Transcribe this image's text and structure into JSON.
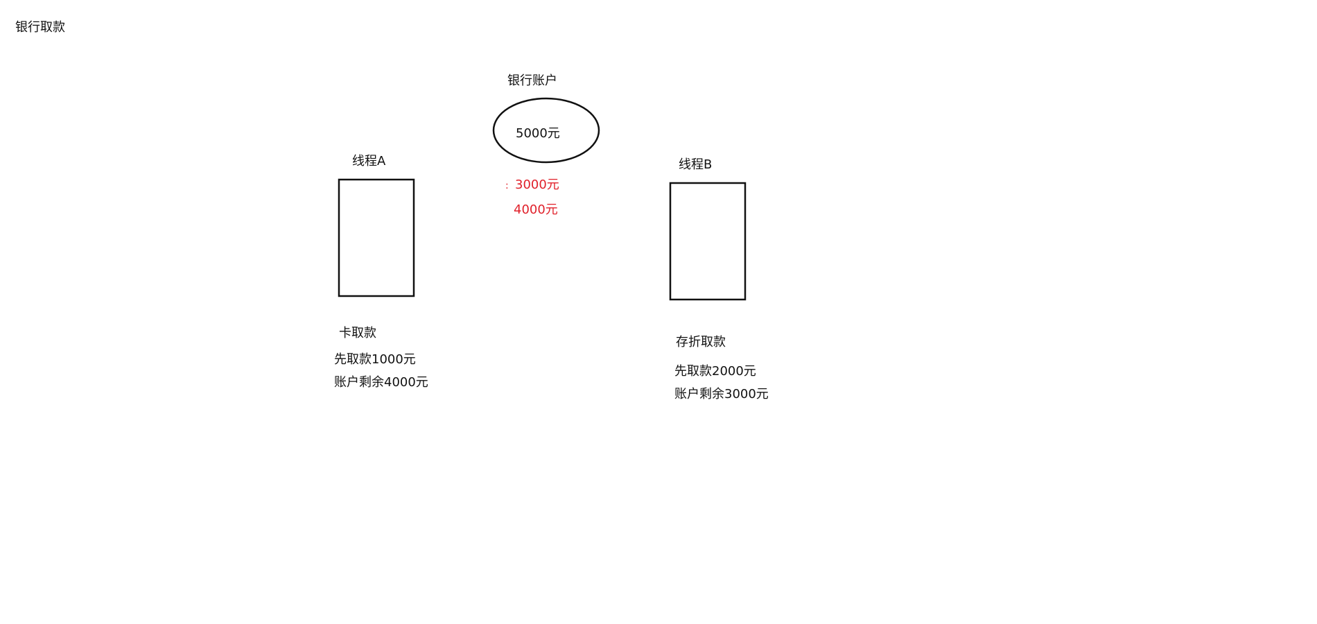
{
  "title": "银行取款",
  "account": {
    "label": "银行账户",
    "amount": "5000元",
    "results": [
      "3000元",
      "4000元"
    ],
    "result_marker": ":"
  },
  "thread_a": {
    "label": "线程A",
    "method": "卡取款",
    "withdraw": "先取款1000元",
    "remaining": "账户剩余4000元"
  },
  "thread_b": {
    "label": "线程B",
    "method": "存折取款",
    "withdraw": "先取款2000元",
    "remaining": "账户剩余3000元"
  },
  "colors": {
    "stroke": "#111111",
    "highlight": "#e0202a"
  }
}
